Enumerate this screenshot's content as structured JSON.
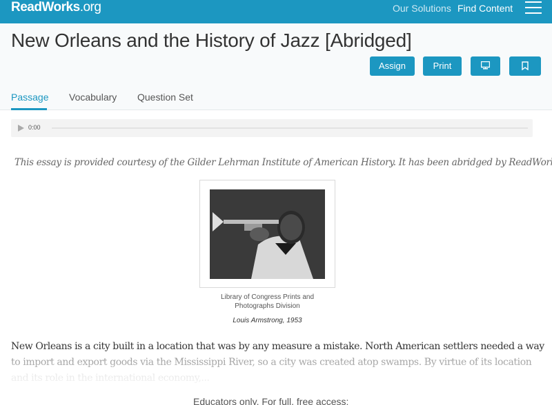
{
  "topbar": {
    "logo_main": "ReadWorks",
    "logo_suffix": ".org",
    "nav": {
      "solutions": "Our Solutions",
      "find": "Find Content"
    },
    "menu_icon": "hamburger-menu-icon",
    "color": "#1c97c1"
  },
  "article": {
    "title": "New Orleans and the History of Jazz [Abridged]",
    "buttons": {
      "assign": "Assign",
      "print": "Print",
      "present_icon": "monitor-icon",
      "bookmark_icon": "bookmark-icon"
    },
    "tabs": {
      "passage": "Passage",
      "vocabulary": "Vocabulary",
      "questions": "Question Set",
      "active": "Passage"
    }
  },
  "audio": {
    "time": "0:00",
    "progress": 0,
    "play_icon": "play-icon"
  },
  "passage": {
    "courtesy": "This essay is provided courtesy of the Gilder Lehrman Institute of American History. It has been abridged by ReadWorks.",
    "image_credit": "Library of Congress Prints and Photographs Division",
    "image_caption": "Louis Armstrong, 1953",
    "lines": [
      "New Orleans is a city built in a location that was by any measure a mistake. North American settlers needed a way",
      "to import and export goods via the Mississippi River, so a city was created atop swamps. By virtue of its location",
      "and its role in the international economy,..."
    ],
    "educators_note": "Educators only. For full, free access:"
  }
}
